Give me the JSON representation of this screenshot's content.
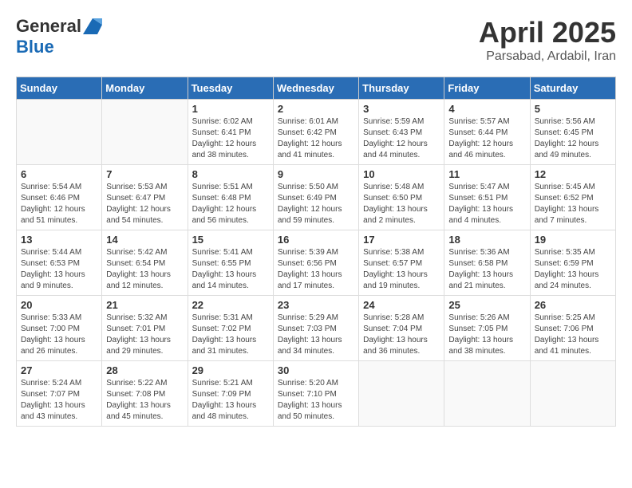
{
  "header": {
    "logo_general": "General",
    "logo_blue": "Blue",
    "month": "April 2025",
    "location": "Parsabad, Ardabil, Iran"
  },
  "weekdays": [
    "Sunday",
    "Monday",
    "Tuesday",
    "Wednesday",
    "Thursday",
    "Friday",
    "Saturday"
  ],
  "weeks": [
    [
      {
        "day": "",
        "sunrise": "",
        "sunset": "",
        "daylight": ""
      },
      {
        "day": "",
        "sunrise": "",
        "sunset": "",
        "daylight": ""
      },
      {
        "day": "1",
        "sunrise": "Sunrise: 6:02 AM",
        "sunset": "Sunset: 6:41 PM",
        "daylight": "Daylight: 12 hours and 38 minutes."
      },
      {
        "day": "2",
        "sunrise": "Sunrise: 6:01 AM",
        "sunset": "Sunset: 6:42 PM",
        "daylight": "Daylight: 12 hours and 41 minutes."
      },
      {
        "day": "3",
        "sunrise": "Sunrise: 5:59 AM",
        "sunset": "Sunset: 6:43 PM",
        "daylight": "Daylight: 12 hours and 44 minutes."
      },
      {
        "day": "4",
        "sunrise": "Sunrise: 5:57 AM",
        "sunset": "Sunset: 6:44 PM",
        "daylight": "Daylight: 12 hours and 46 minutes."
      },
      {
        "day": "5",
        "sunrise": "Sunrise: 5:56 AM",
        "sunset": "Sunset: 6:45 PM",
        "daylight": "Daylight: 12 hours and 49 minutes."
      }
    ],
    [
      {
        "day": "6",
        "sunrise": "Sunrise: 5:54 AM",
        "sunset": "Sunset: 6:46 PM",
        "daylight": "Daylight: 12 hours and 51 minutes."
      },
      {
        "day": "7",
        "sunrise": "Sunrise: 5:53 AM",
        "sunset": "Sunset: 6:47 PM",
        "daylight": "Daylight: 12 hours and 54 minutes."
      },
      {
        "day": "8",
        "sunrise": "Sunrise: 5:51 AM",
        "sunset": "Sunset: 6:48 PM",
        "daylight": "Daylight: 12 hours and 56 minutes."
      },
      {
        "day": "9",
        "sunrise": "Sunrise: 5:50 AM",
        "sunset": "Sunset: 6:49 PM",
        "daylight": "Daylight: 12 hours and 59 minutes."
      },
      {
        "day": "10",
        "sunrise": "Sunrise: 5:48 AM",
        "sunset": "Sunset: 6:50 PM",
        "daylight": "Daylight: 13 hours and 2 minutes."
      },
      {
        "day": "11",
        "sunrise": "Sunrise: 5:47 AM",
        "sunset": "Sunset: 6:51 PM",
        "daylight": "Daylight: 13 hours and 4 minutes."
      },
      {
        "day": "12",
        "sunrise": "Sunrise: 5:45 AM",
        "sunset": "Sunset: 6:52 PM",
        "daylight": "Daylight: 13 hours and 7 minutes."
      }
    ],
    [
      {
        "day": "13",
        "sunrise": "Sunrise: 5:44 AM",
        "sunset": "Sunset: 6:53 PM",
        "daylight": "Daylight: 13 hours and 9 minutes."
      },
      {
        "day": "14",
        "sunrise": "Sunrise: 5:42 AM",
        "sunset": "Sunset: 6:54 PM",
        "daylight": "Daylight: 13 hours and 12 minutes."
      },
      {
        "day": "15",
        "sunrise": "Sunrise: 5:41 AM",
        "sunset": "Sunset: 6:55 PM",
        "daylight": "Daylight: 13 hours and 14 minutes."
      },
      {
        "day": "16",
        "sunrise": "Sunrise: 5:39 AM",
        "sunset": "Sunset: 6:56 PM",
        "daylight": "Daylight: 13 hours and 17 minutes."
      },
      {
        "day": "17",
        "sunrise": "Sunrise: 5:38 AM",
        "sunset": "Sunset: 6:57 PM",
        "daylight": "Daylight: 13 hours and 19 minutes."
      },
      {
        "day": "18",
        "sunrise": "Sunrise: 5:36 AM",
        "sunset": "Sunset: 6:58 PM",
        "daylight": "Daylight: 13 hours and 21 minutes."
      },
      {
        "day": "19",
        "sunrise": "Sunrise: 5:35 AM",
        "sunset": "Sunset: 6:59 PM",
        "daylight": "Daylight: 13 hours and 24 minutes."
      }
    ],
    [
      {
        "day": "20",
        "sunrise": "Sunrise: 5:33 AM",
        "sunset": "Sunset: 7:00 PM",
        "daylight": "Daylight: 13 hours and 26 minutes."
      },
      {
        "day": "21",
        "sunrise": "Sunrise: 5:32 AM",
        "sunset": "Sunset: 7:01 PM",
        "daylight": "Daylight: 13 hours and 29 minutes."
      },
      {
        "day": "22",
        "sunrise": "Sunrise: 5:31 AM",
        "sunset": "Sunset: 7:02 PM",
        "daylight": "Daylight: 13 hours and 31 minutes."
      },
      {
        "day": "23",
        "sunrise": "Sunrise: 5:29 AM",
        "sunset": "Sunset: 7:03 PM",
        "daylight": "Daylight: 13 hours and 34 minutes."
      },
      {
        "day": "24",
        "sunrise": "Sunrise: 5:28 AM",
        "sunset": "Sunset: 7:04 PM",
        "daylight": "Daylight: 13 hours and 36 minutes."
      },
      {
        "day": "25",
        "sunrise": "Sunrise: 5:26 AM",
        "sunset": "Sunset: 7:05 PM",
        "daylight": "Daylight: 13 hours and 38 minutes."
      },
      {
        "day": "26",
        "sunrise": "Sunrise: 5:25 AM",
        "sunset": "Sunset: 7:06 PM",
        "daylight": "Daylight: 13 hours and 41 minutes."
      }
    ],
    [
      {
        "day": "27",
        "sunrise": "Sunrise: 5:24 AM",
        "sunset": "Sunset: 7:07 PM",
        "daylight": "Daylight: 13 hours and 43 minutes."
      },
      {
        "day": "28",
        "sunrise": "Sunrise: 5:22 AM",
        "sunset": "Sunset: 7:08 PM",
        "daylight": "Daylight: 13 hours and 45 minutes."
      },
      {
        "day": "29",
        "sunrise": "Sunrise: 5:21 AM",
        "sunset": "Sunset: 7:09 PM",
        "daylight": "Daylight: 13 hours and 48 minutes."
      },
      {
        "day": "30",
        "sunrise": "Sunrise: 5:20 AM",
        "sunset": "Sunset: 7:10 PM",
        "daylight": "Daylight: 13 hours and 50 minutes."
      },
      {
        "day": "",
        "sunrise": "",
        "sunset": "",
        "daylight": ""
      },
      {
        "day": "",
        "sunrise": "",
        "sunset": "",
        "daylight": ""
      },
      {
        "day": "",
        "sunrise": "",
        "sunset": "",
        "daylight": ""
      }
    ]
  ]
}
